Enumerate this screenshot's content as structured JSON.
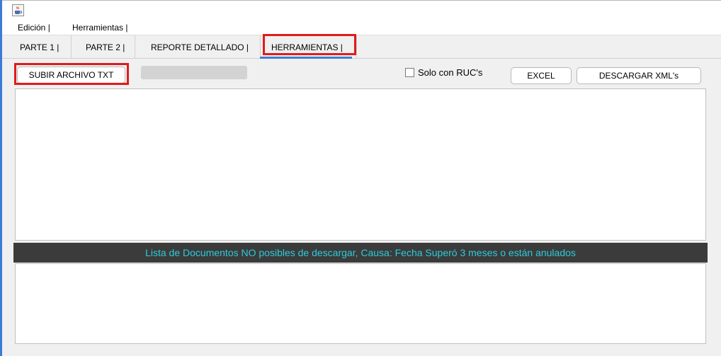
{
  "menu": {
    "items": [
      {
        "label": "Edición  |"
      },
      {
        "label": "Herramientas  |"
      }
    ]
  },
  "tabs": [
    {
      "label": "PARTE 1    |",
      "selected": false
    },
    {
      "label": "PARTE 2    |",
      "selected": false
    },
    {
      "label": "REPORTE DETALLADO    |",
      "selected": false
    },
    {
      "label": "HERRAMIENTAS    |",
      "selected": true
    }
  ],
  "toolbar": {
    "upload_label": "SUBIR ARCHIVO TXT",
    "progress": 0,
    "only_ruc_label": "Solo con RUC's",
    "only_ruc_checked": false,
    "excel_label": "EXCEL",
    "download_xml_label": "DESCARGAR XML's"
  },
  "banner": {
    "text": "Lista de Documentos NO posibles de descargar, Causa: Fecha Superó 3 meses o están anulados"
  },
  "colors": {
    "accent": "#3d7ed6",
    "banner_bg": "#3b3b3b",
    "banner_text": "#2ccbdc",
    "highlight": "#e01b1b"
  },
  "icons": {
    "app": "java-cup-icon",
    "checkbox": "checkbox-unchecked-icon"
  }
}
